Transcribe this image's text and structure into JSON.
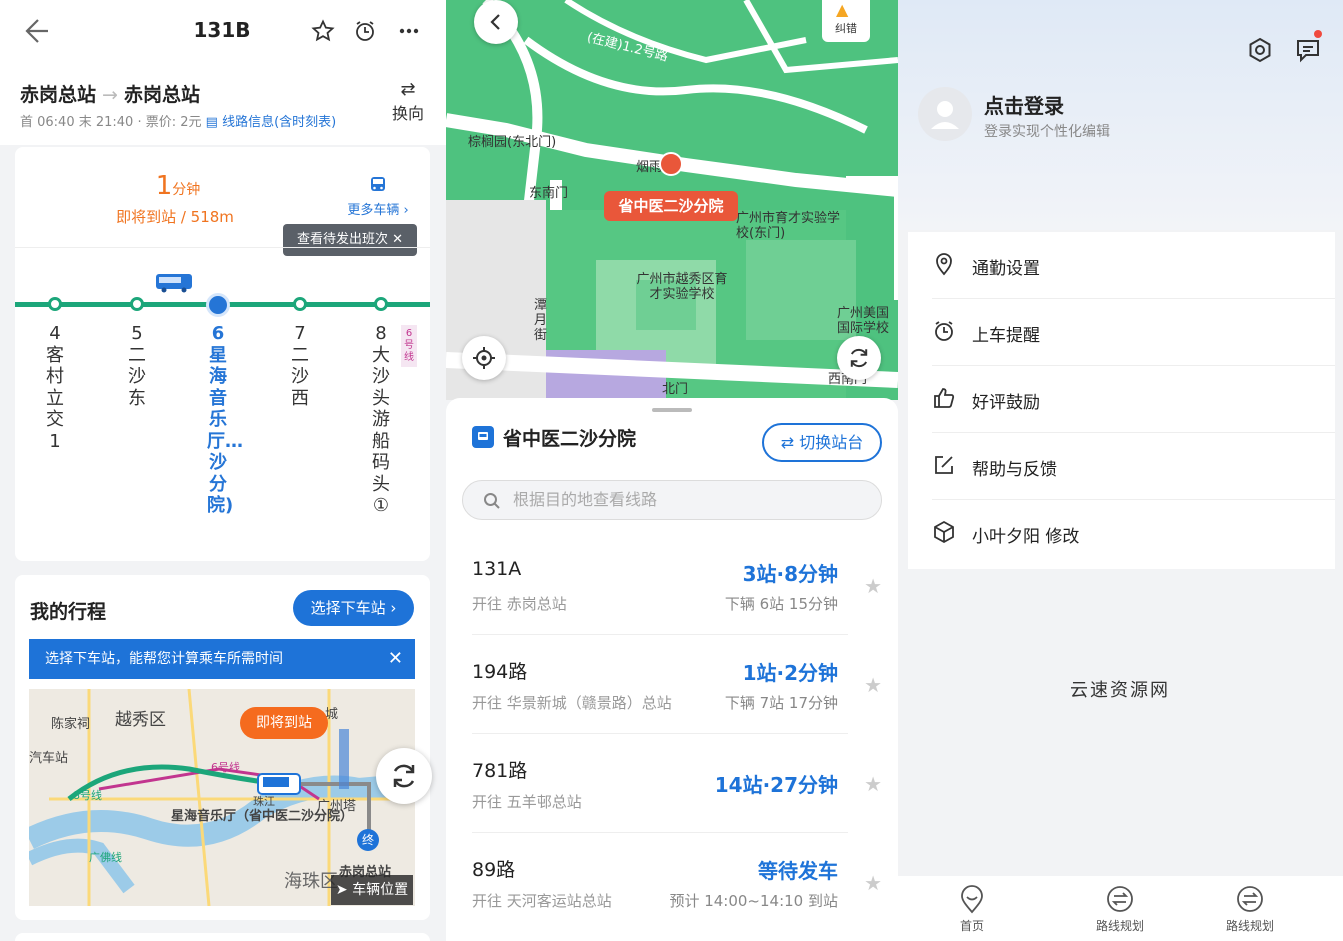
{
  "p1": {
    "title": "131B",
    "from": "赤岗总站",
    "arrow": "→",
    "to": "赤岗总站",
    "meta": "首 06:40 末 21:40 · 票价: 2元",
    "info_link": "线路信息(含时刻表)",
    "reverse": "换向",
    "arrive_num": "1",
    "arrive_unit": "分钟",
    "arrive_sub": "即将到站 / 518m",
    "more_bus": "更多车辆 ›",
    "tip": "查看待发出班次 ✕",
    "stops": [
      {
        "name": "4客村立交1",
        "cur": false
      },
      {
        "name": "5二沙东",
        "cur": false
      },
      {
        "name": "6星海音乐厅…沙分院)",
        "cur": true
      },
      {
        "name": "7二沙西",
        "cur": false
      },
      {
        "name": "8大沙头游船码头①",
        "cur": false
      }
    ],
    "line6": "6号线",
    "mytrip": "我的行程",
    "select_btn": "选择下车站 ›",
    "hint": "选择下车站，能帮您计算乘车所需时间",
    "hint_close": "✕",
    "map": {
      "bubble": "即将到站",
      "labels": [
        "陈家祠",
        "越秀区",
        "汽车站",
        "6号线",
        "8号线",
        "广佛线",
        "星海音乐厅（省中医二沙分院）",
        "广州塔",
        "赤岗总站",
        "海珠区",
        "珠江",
        "城",
        "终"
      ],
      "vehicle_pos": "车辆位置"
    }
  },
  "p2": {
    "jiucuo": "纠错",
    "map_labels": [
      "棕榈园(东北门)",
      "东南门",
      "烟雨",
      "广州市育才实验学校(东门)",
      "广州市越秀区育才实验学校",
      "潭月街",
      "广州美国国际学校",
      "北门",
      "西南门",
      "(在建)1.2号路"
    ],
    "station_pill": "省中医二沙分院",
    "station_name": "省中医二沙分院",
    "switch": "⇄ 切换站台",
    "search_placeholder": "根据目的地查看线路",
    "routes": [
      {
        "name": "131A",
        "dir": "开往 赤岗总站",
        "time": "3站·8分钟",
        "next": "下辆 6站 15分钟"
      },
      {
        "name": "194路",
        "dir": "开往 华景新城（赣景路）总站",
        "time": "1站·2分钟",
        "next": "下辆 7站 17分钟"
      },
      {
        "name": "781路",
        "dir": "开往 五羊邨总站",
        "time": "14站·27分钟",
        "next": ""
      },
      {
        "name": "89路",
        "dir": "开往 天河客运站总站",
        "time": "等待发车",
        "next": "预计 14:00~14:10 到站"
      }
    ],
    "star": "★"
  },
  "p3": {
    "login": "点击登录",
    "login_sub": "登录实现个性化编辑",
    "menu": [
      {
        "label": "通勤设置",
        "icon": "location-pin-icon"
      },
      {
        "label": "上车提醒",
        "icon": "alarm-clock-icon"
      },
      {
        "label": "好评鼓励",
        "icon": "thumbs-up-icon"
      },
      {
        "label": "帮助与反馈",
        "icon": "edit-icon"
      },
      {
        "label": "小叶夕阳 修改",
        "icon": "cube-icon"
      }
    ],
    "watermark": "云速资源网",
    "tabs": [
      "首页",
      "路线规划",
      "路线规划"
    ]
  },
  "colors": {
    "accent": "#1e73d8",
    "green": "#1ca67a",
    "orange": "#f07420",
    "red": "#e9573a"
  }
}
